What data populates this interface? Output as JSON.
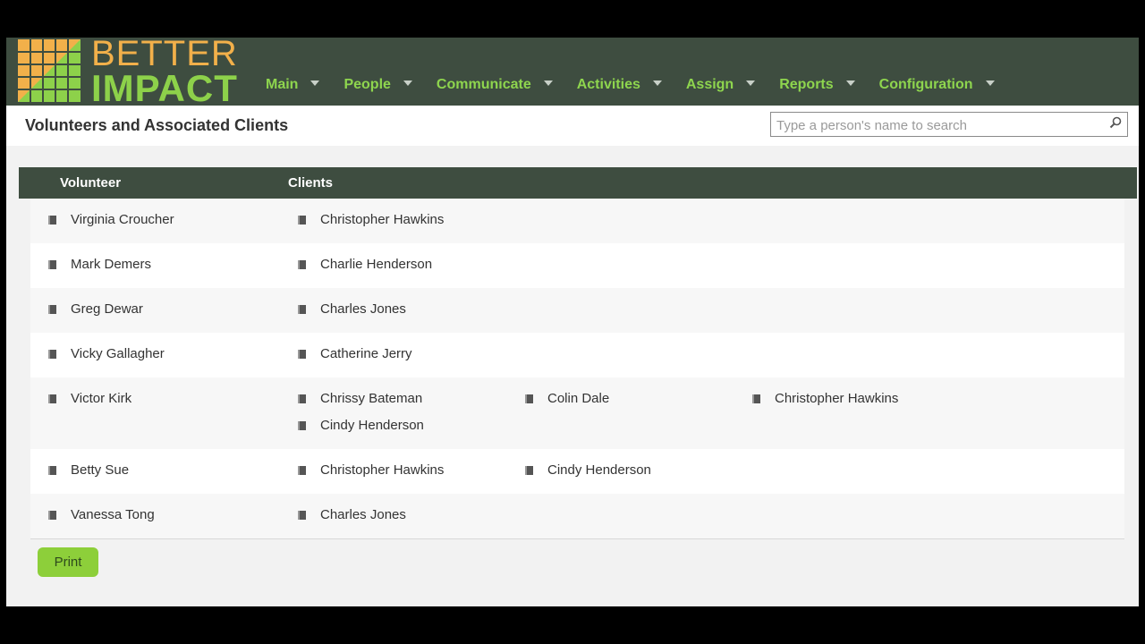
{
  "brand": {
    "line1": "BETTER",
    "line2": "IMPACT"
  },
  "nav": [
    {
      "label": "Main"
    },
    {
      "label": "People"
    },
    {
      "label": "Communicate"
    },
    {
      "label": "Activities"
    },
    {
      "label": "Assign"
    },
    {
      "label": "Reports"
    },
    {
      "label": "Configuration"
    }
  ],
  "page": {
    "title": "Volunteers and Associated Clients"
  },
  "search": {
    "placeholder": "Type a person's name to search"
  },
  "table": {
    "headers": {
      "volunteer": "Volunteer",
      "clients": "Clients"
    },
    "rows": [
      {
        "volunteer": "Virginia Croucher",
        "clients": [
          "Christopher Hawkins"
        ]
      },
      {
        "volunteer": "Mark Demers",
        "clients": [
          "Charlie Henderson"
        ]
      },
      {
        "volunteer": "Greg Dewar",
        "clients": [
          "Charles Jones"
        ]
      },
      {
        "volunteer": "Vicky Gallagher",
        "clients": [
          "Catherine Jerry"
        ]
      },
      {
        "volunteer": "Victor Kirk",
        "clients": [
          "Chrissy Bateman",
          "Colin Dale",
          "Christopher Hawkins",
          "Cindy Henderson"
        ]
      },
      {
        "volunteer": "Betty Sue",
        "clients": [
          "Christopher Hawkins",
          "Cindy Henderson"
        ]
      },
      {
        "volunteer": "Vanessa Tong",
        "clients": [
          "Charles Jones"
        ]
      }
    ]
  },
  "actions": {
    "print_label": "Print"
  },
  "colors": {
    "topbar": "#3e4d40",
    "nav_text": "#8ed54e",
    "brand_orange": "#f2b04a",
    "brand_green": "#8dd14a",
    "print_button": "#8dcf3a"
  }
}
